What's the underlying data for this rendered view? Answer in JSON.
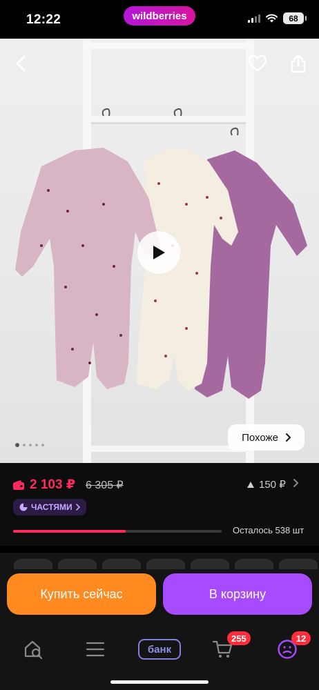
{
  "status_bar": {
    "time": "12:22",
    "brand": "wildberries",
    "battery": "68"
  },
  "gallery": {
    "similar_label": "Похоже",
    "slides_count": 5,
    "active_slide": 1
  },
  "price": {
    "current": "2 103 ₽",
    "old": "6 305 ₽",
    "cashback": "150 ₽",
    "installments": "ЧАСТЯМИ"
  },
  "stock": {
    "remaining_text": "Осталось 538 шт",
    "sold_fraction": 0.54
  },
  "actions": {
    "buy_now": "Купить сейчас",
    "to_cart": "В корзину"
  },
  "tabbar": {
    "bank_label": "банк",
    "cart_badge": "255",
    "profile_badge": "12"
  },
  "colors": {
    "accent_pink": "#ff2b5e",
    "buy_orange": "#ff8a1f",
    "cart_purple": "#a64bff",
    "brand_gradient_start": "#b416d9",
    "brand_gradient_end": "#d9159f"
  }
}
